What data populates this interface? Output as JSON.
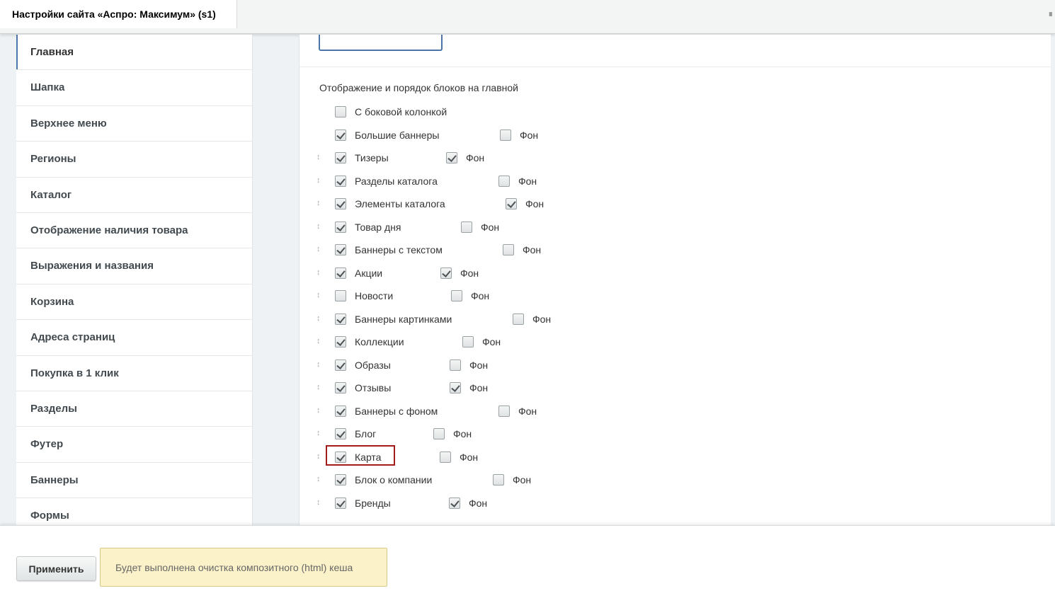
{
  "window": {
    "tab_title": "Настройки сайта «Аспро: Максимум» (s1)"
  },
  "sidebar": {
    "items": [
      {
        "label": "Главная",
        "active": true
      },
      {
        "label": "Шапка"
      },
      {
        "label": "Верхнее меню"
      },
      {
        "label": "Регионы"
      },
      {
        "label": "Каталог"
      },
      {
        "label": "Отображение наличия товара"
      },
      {
        "label": "Выражения и названия"
      },
      {
        "label": "Корзина"
      },
      {
        "label": "Адреса страниц"
      },
      {
        "label": "Покупка в 1 клик"
      },
      {
        "label": "Разделы"
      },
      {
        "label": "Футер"
      },
      {
        "label": "Баннеры"
      },
      {
        "label": "Формы"
      }
    ]
  },
  "main": {
    "section_title": "Отображение и порядок блоков на главной",
    "fon_label": "Фон",
    "blocks": [
      {
        "label": "С боковой колонкой",
        "checked": false,
        "draggable": false,
        "has_fon": false
      },
      {
        "label": "Большие баннеры",
        "checked": true,
        "draggable": false,
        "has_fon": true,
        "fon_checked": false
      },
      {
        "label": "Тизеры",
        "checked": true,
        "draggable": true,
        "has_fon": true,
        "fon_checked": true
      },
      {
        "label": "Разделы каталога",
        "checked": true,
        "draggable": true,
        "has_fon": true,
        "fon_checked": false
      },
      {
        "label": "Элементы каталога",
        "checked": true,
        "draggable": true,
        "has_fon": true,
        "fon_checked": true
      },
      {
        "label": "Товар дня",
        "checked": true,
        "draggable": true,
        "has_fon": true,
        "fon_checked": false
      },
      {
        "label": "Баннеры с текстом",
        "checked": true,
        "draggable": true,
        "has_fon": true,
        "fon_checked": false
      },
      {
        "label": "Акции",
        "checked": true,
        "draggable": true,
        "has_fon": true,
        "fon_checked": true
      },
      {
        "label": "Новости",
        "checked": false,
        "draggable": true,
        "has_fon": true,
        "fon_checked": false
      },
      {
        "label": "Баннеры картинками",
        "checked": true,
        "draggable": true,
        "has_fon": true,
        "fon_checked": false
      },
      {
        "label": "Коллекции",
        "checked": true,
        "draggable": true,
        "has_fon": true,
        "fon_checked": false
      },
      {
        "label": "Образы",
        "checked": true,
        "draggable": true,
        "has_fon": true,
        "fon_checked": false
      },
      {
        "label": "Отзывы",
        "checked": true,
        "draggable": true,
        "has_fon": true,
        "fon_checked": true
      },
      {
        "label": "Баннеры с фоном",
        "checked": true,
        "draggable": true,
        "has_fon": true,
        "fon_checked": false
      },
      {
        "label": "Блог",
        "checked": true,
        "draggable": true,
        "has_fon": true,
        "fon_checked": false
      },
      {
        "label": "Карта",
        "checked": true,
        "draggable": true,
        "has_fon": true,
        "fon_checked": false,
        "highlighted": true
      },
      {
        "label": "Блок о компании",
        "checked": true,
        "draggable": true,
        "has_fon": true,
        "fon_checked": false
      },
      {
        "label": "Бренды",
        "checked": true,
        "draggable": true,
        "has_fon": true,
        "fon_checked": true
      }
    ]
  },
  "footer": {
    "apply_label": "Применить",
    "notice": "Будет выполнена очистка композитного (html) кеша"
  }
}
